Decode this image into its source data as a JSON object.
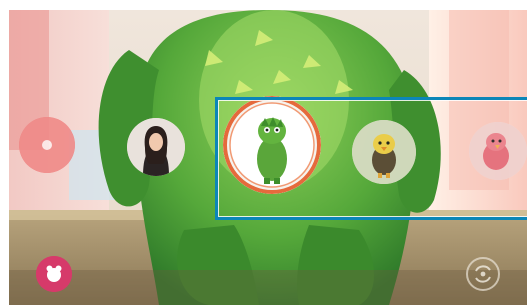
{
  "screen": {
    "description_free": true
  },
  "avatar_carousel": {
    "items": [
      {
        "id": "effect-shortcut",
        "icon": "effect-icon",
        "kind": "button"
      },
      {
        "id": "my-emoji",
        "icon": "human-avatar"
      },
      {
        "id": "dinosaur",
        "icon": "green-dinosaur-character",
        "selected": true
      },
      {
        "id": "chick",
        "icon": "yellow-chick-character"
      },
      {
        "id": "pink-bird",
        "icon": "pink-bird-character"
      }
    ]
  },
  "bottom_bar": {
    "left_button_icon": "sticker-icon",
    "right_button_icon": "switch-camera-icon"
  },
  "colors": {
    "highlight": "#0b86b8",
    "selected_ring": "#e56a3c",
    "sticker_button": "#d63a6a"
  }
}
